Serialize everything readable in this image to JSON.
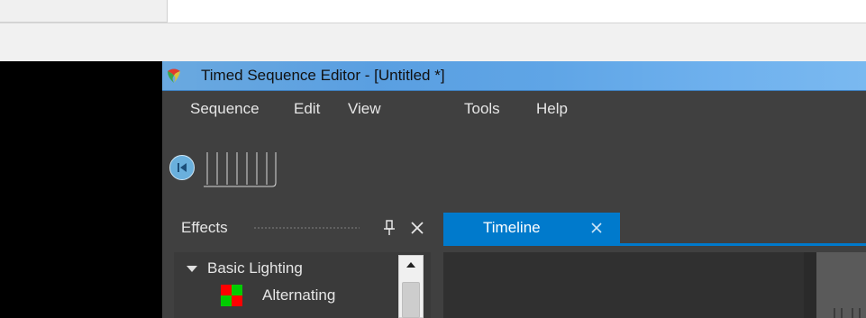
{
  "window": {
    "title": "Timed Sequence Editor - [Untitled *]",
    "icon": "vixen-logo-icon",
    "accent_color": "#007acc",
    "titlebar_color": "#5fa5e6"
  },
  "menubar": {
    "items": [
      {
        "label": "Sequence"
      },
      {
        "label": "Edit"
      },
      {
        "label": "View"
      },
      {
        "label": "Tools"
      },
      {
        "label": "Help"
      }
    ]
  },
  "toolbar": {
    "rewind_icon": "skip-to-start-icon"
  },
  "effects_panel": {
    "title": "Effects",
    "pin_icon": "pin-icon",
    "close_icon": "close-icon",
    "tree": [
      {
        "label": "Basic Lighting",
        "expanded": true,
        "icon": "triangle-down-icon"
      },
      {
        "label": "Alternating",
        "icon": "alternating-swatch-icon",
        "colors": [
          "#ff0000",
          "#00cc00"
        ]
      }
    ]
  },
  "timeline": {
    "tab_label": "Timeline",
    "close_icon": "close-icon"
  }
}
